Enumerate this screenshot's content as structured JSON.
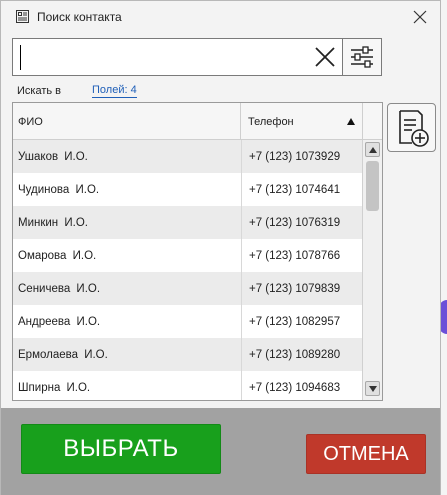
{
  "window": {
    "title": "Поиск контакта"
  },
  "search": {
    "value": "",
    "placeholder": ""
  },
  "filter": {
    "search_in_label": "Искать в",
    "fields_link": "Полей: 4"
  },
  "table": {
    "columns": [
      "ФИО",
      "Телефон"
    ],
    "sort_column": "Телефон",
    "sort_direction": "ascending",
    "rows": [
      {
        "name": "Ушаков  И.О.",
        "phone": "+7 (123) 1073929"
      },
      {
        "name": "Чудинова  И.О.",
        "phone": "+7 (123) 1074641"
      },
      {
        "name": "Минкин  И.О.",
        "phone": "+7 (123) 1076319"
      },
      {
        "name": "Омарова  И.О.",
        "phone": "+7 (123) 1078766"
      },
      {
        "name": "Сеничева  И.О.",
        "phone": "+7 (123) 1079839"
      },
      {
        "name": "Андреева  И.О.",
        "phone": "+7 (123) 1082957"
      },
      {
        "name": "Ермолаева  И.О.",
        "phone": "+7 (123) 1089280"
      },
      {
        "name": "Шпирна  И.О.",
        "phone": "+7 (123) 1094683"
      }
    ]
  },
  "actions": {
    "select_label": "ВЫБРАТЬ",
    "cancel_label": "ОТМЕНА"
  },
  "icons": {
    "title": "contact-card-icon",
    "close": "close-icon",
    "clear": "clear-x-icon",
    "filter": "sliders-icon",
    "add_contact": "add-document-icon",
    "sort": "sort-ascending-icon"
  },
  "colors": {
    "select_button": "#18a01c",
    "cancel_button": "#c0392b",
    "link": "#1f5fb8",
    "footer": "#a2a2a2"
  }
}
